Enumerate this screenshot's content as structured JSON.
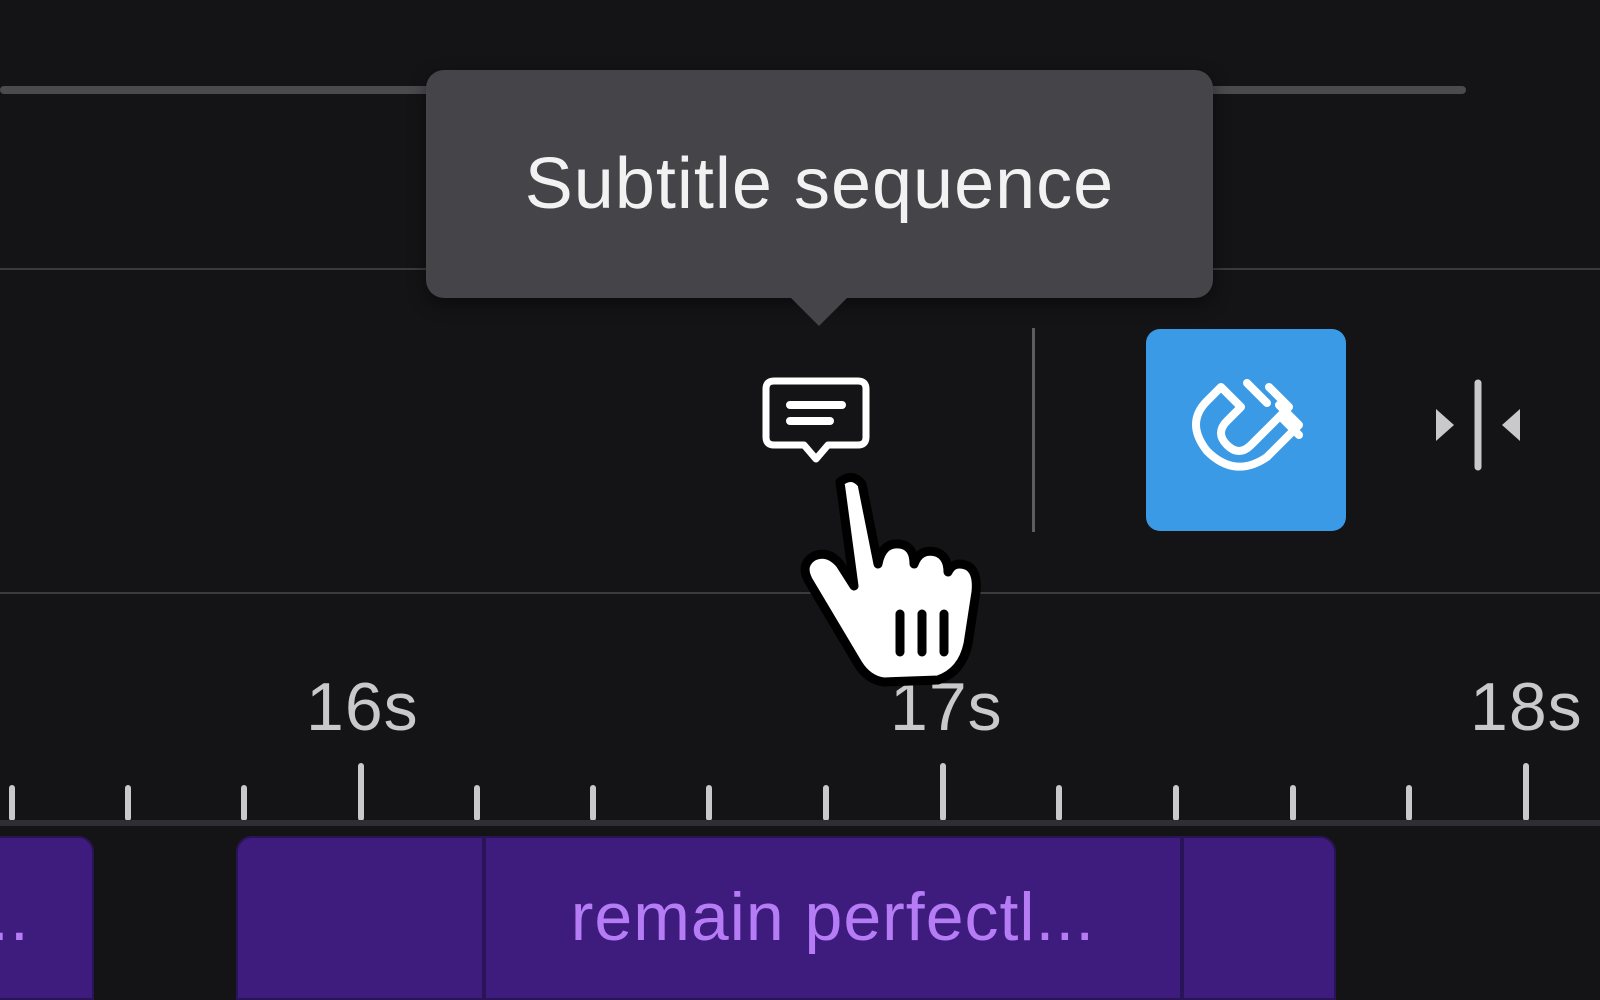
{
  "tooltip": {
    "text": "Subtitle sequence"
  },
  "toolbar": {
    "subtitle_icon": "subtitle-icon",
    "magnet_icon": "magnet-icon",
    "split_icon": "split-icon",
    "magnet_active_color": "#3a9ae6"
  },
  "ruler": {
    "labels": [
      "16s",
      "17s",
      "18s"
    ]
  },
  "clips": [
    {
      "text": ".."
    },
    {
      "text": ""
    },
    {
      "text": "remain perfectl..."
    },
    {
      "text": ""
    }
  ],
  "colors": {
    "background": "#141417",
    "clip_fill": "#3d1c7d",
    "clip_text": "#b67cf5"
  }
}
